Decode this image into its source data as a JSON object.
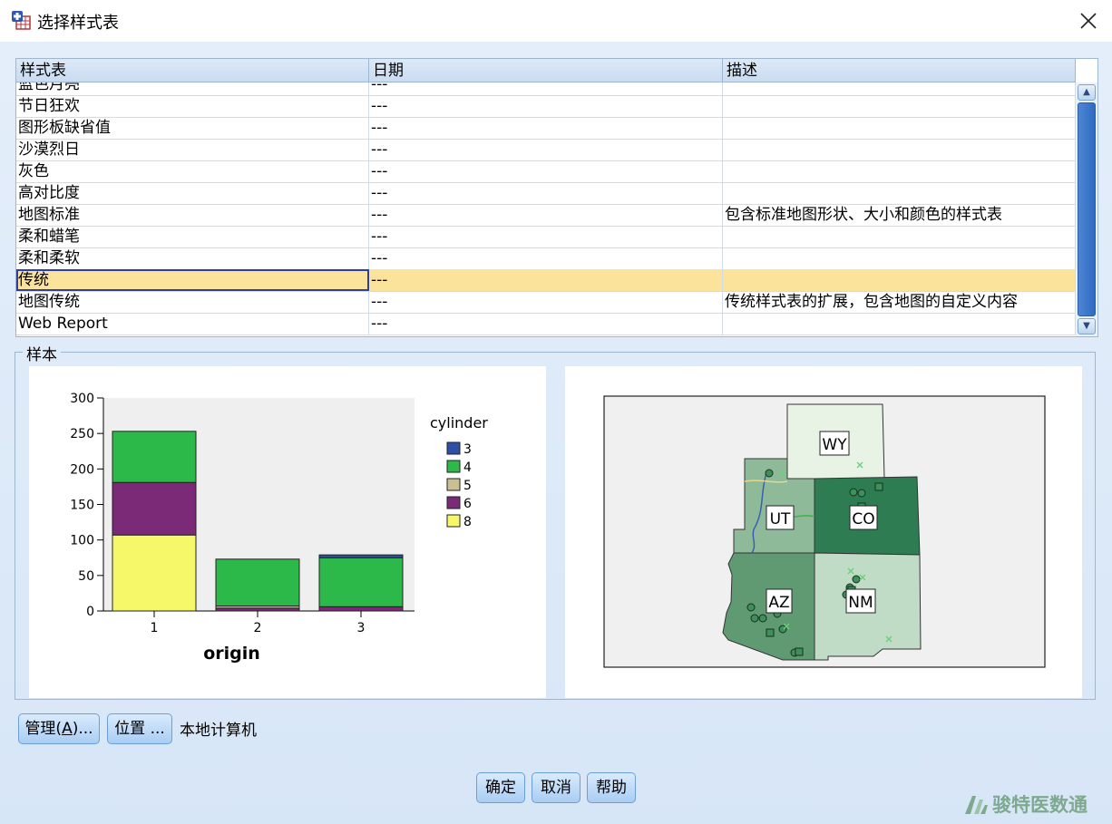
{
  "window": {
    "title": "选择样式表"
  },
  "table": {
    "columns": [
      "样式表",
      "日期",
      "描述"
    ],
    "rows": [
      {
        "name": "蓝色月亮",
        "date": "---",
        "desc": ""
      },
      {
        "name": "节日狂欢",
        "date": "---",
        "desc": ""
      },
      {
        "name": "图形板缺省值",
        "date": "---",
        "desc": ""
      },
      {
        "name": "沙漠烈日",
        "date": "---",
        "desc": ""
      },
      {
        "name": "灰色",
        "date": "---",
        "desc": ""
      },
      {
        "name": "高对比度",
        "date": "---",
        "desc": ""
      },
      {
        "name": "地图标准",
        "date": "---",
        "desc": "包含标准地图形状、大小和颜色的样式表"
      },
      {
        "name": "柔和蜡笔",
        "date": "---",
        "desc": ""
      },
      {
        "name": "柔和柔软",
        "date": "---",
        "desc": ""
      },
      {
        "name": "传统",
        "date": "---",
        "desc": "",
        "selected": true
      },
      {
        "name": "地图传统",
        "date": "---",
        "desc": "传统样式表的扩展，包含地图的自定义内容"
      },
      {
        "name": "Web Report",
        "date": "---",
        "desc": ""
      }
    ]
  },
  "sample": {
    "label": "样本"
  },
  "chart_data": {
    "type": "bar",
    "stacked": true,
    "categories": [
      "1",
      "2",
      "3"
    ],
    "xlabel": "origin",
    "ylabel": "",
    "ylim": [
      0,
      300
    ],
    "yticks": [
      "0",
      "50",
      "100",
      "150",
      "200",
      "250",
      "300"
    ],
    "legend_title": "cylinder",
    "series": [
      {
        "name": "3",
        "color": "#2f4fa6",
        "values": [
          0,
          0,
          4
        ]
      },
      {
        "name": "4",
        "color": "#2db84a",
        "values": [
          72,
          66,
          69
        ]
      },
      {
        "name": "5",
        "color": "#c8c090",
        "values": [
          0,
          3,
          0
        ]
      },
      {
        "name": "6",
        "color": "#7b2a78",
        "values": [
          74,
          4,
          6
        ]
      },
      {
        "name": "8",
        "color": "#f7f76a",
        "values": [
          107,
          0,
          0
        ]
      }
    ]
  },
  "map": {
    "states": [
      {
        "label": "WY",
        "color": "#e8f3e6"
      },
      {
        "label": "UT",
        "color": "#8fba9a"
      },
      {
        "label": "CO",
        "color": "#2e7d52"
      },
      {
        "label": "AZ",
        "color": "#5f9a72"
      },
      {
        "label": "NM",
        "color": "#c0dcc6"
      }
    ]
  },
  "buttons": {
    "manage": "管理(A)...",
    "manage_main": "管理(",
    "manage_mnemonic": "A",
    "manage_end": ")...",
    "location": "位置 ...",
    "location_label": "本地计算机",
    "ok": "确定",
    "cancel": "取消",
    "help": "帮助"
  },
  "watermark": "骏特医数通"
}
